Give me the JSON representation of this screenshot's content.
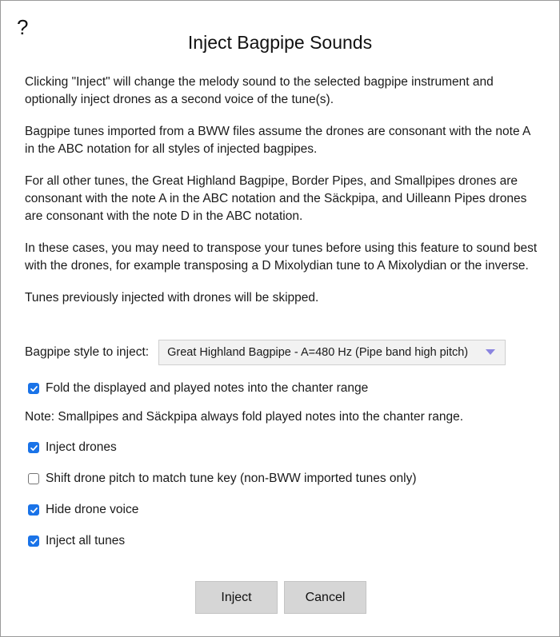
{
  "dialog": {
    "help_label": "?",
    "title": "Inject Bagpipe Sounds",
    "paragraphs": [
      "Clicking \"Inject\" will change the melody sound to the selected bagpipe instrument and optionally inject drones as a second voice of the tune(s).",
      "Bagpipe tunes imported from a BWW files assume the drones are consonant with the note A in the ABC notation for all styles of injected bagpipes.",
      "For all other tunes, the Great Highland Bagpipe, Border Pipes, and Smallpipes drones are consonant with the note A in the ABC notation and the Säckpipa, and Uilleann Pipes drones are consonant with the note D in the ABC notation.",
      "In these cases, you may need to transpose your tunes before using this feature to sound best with the drones, for example transposing a D Mixolydian tune to A Mixolydian or the inverse.",
      "Tunes previously injected with drones will be skipped."
    ],
    "style_label": "Bagpipe style to inject:",
    "style_selected": "Great Highland Bagpipe - A=480 Hz (Pipe band high pitch)",
    "fold_option": {
      "label": "Fold the displayed and played notes into the chanter range",
      "checked": true
    },
    "note": "Note: Smallpipes and Säckpipa always fold played notes into the chanter range.",
    "options": [
      {
        "label": "Inject drones",
        "checked": true
      },
      {
        "label": "Shift drone pitch to match tune key (non-BWW imported tunes only)",
        "checked": false
      },
      {
        "label": "Hide drone voice",
        "checked": true
      },
      {
        "label": "Inject all tunes",
        "checked": true
      }
    ],
    "inject_label": "Inject",
    "cancel_label": "Cancel"
  },
  "colors": {
    "checkbox_checked": "#1a73e8",
    "select_arrow": "#8a84e0",
    "button_bg": "#d6d6d6"
  }
}
